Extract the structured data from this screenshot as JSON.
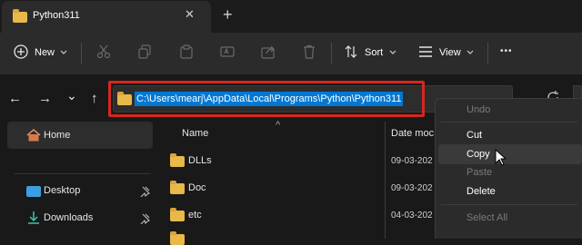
{
  "tab": {
    "title": "Python311",
    "close_glyph": "✕",
    "new_glyph": "+"
  },
  "toolbar": {
    "new_label": "New",
    "sort_label": "Sort",
    "view_label": "View",
    "more_glyph": "•••"
  },
  "nav": {
    "back": "←",
    "forward": "→",
    "recent": "⌄",
    "up": "↑"
  },
  "address": {
    "path": "C:\\Users\\mearj\\AppData\\Local\\Programs\\Python\\Python311"
  },
  "columns": {
    "name": "Name",
    "date": "Date moc",
    "sort_arrow": "^"
  },
  "files": [
    {
      "name": "DLLs",
      "date": "09-03-202"
    },
    {
      "name": "Doc",
      "date": "09-03-202"
    },
    {
      "name": "etc",
      "date": "04-03-202"
    }
  ],
  "sidebar": {
    "home": "Home",
    "desktop": "Desktop",
    "downloads": "Downloads"
  },
  "context_menu": {
    "undo": "Undo",
    "cut": "Cut",
    "copy": "Copy",
    "paste": "Paste",
    "delete": "Delete",
    "select_all": "Select All"
  },
  "colors": {
    "highlight": "#d7261f",
    "selection": "#0078d4",
    "folder": "#e9b84a"
  }
}
